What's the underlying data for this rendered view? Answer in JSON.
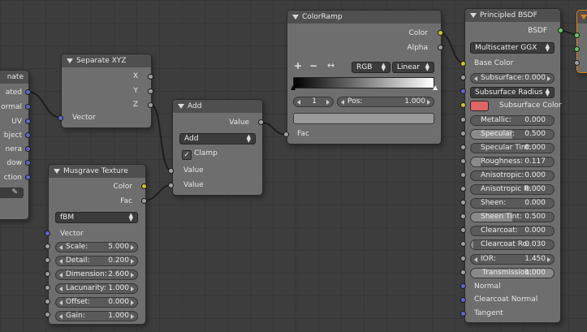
{
  "left_node": {
    "labels": [
      "nate",
      "ated",
      "ormal",
      "UV",
      "bject",
      "nera",
      "dow",
      "ction"
    ]
  },
  "separate_xyz": {
    "title": "Separate XYZ",
    "outputs": [
      "X",
      "Y",
      "Z"
    ],
    "input": "Vector"
  },
  "musgrave": {
    "title": "Musgrave Texture",
    "outputs": [
      "Color",
      "Fac"
    ],
    "mode": "fBM",
    "vector_label": "Vector",
    "params": [
      {
        "label": "Scale:",
        "value": "5.000"
      },
      {
        "label": "Detail:",
        "value": "0.200"
      },
      {
        "label": "Dimension:",
        "value": "2.600"
      },
      {
        "label": "Lacunarity:",
        "value": "1.000"
      },
      {
        "label": "Offset:",
        "value": "0.000"
      },
      {
        "label": "Gain:",
        "value": "1.000"
      }
    ]
  },
  "math_add": {
    "title": "Add",
    "output": "Value",
    "operation": "Add",
    "clamp_label": "Clamp",
    "clamp_checked": true,
    "check_mark": "✓",
    "inputs": [
      "Value",
      "Value"
    ]
  },
  "colorramp": {
    "title": "ColorRamp",
    "outputs": [
      "Color",
      "Alpha"
    ],
    "add_symbol": "+",
    "remove_symbol": "−",
    "flip_symbol": "↔",
    "color_mode": "RGB",
    "interpolation": "Linear",
    "stop_index": "1",
    "pos_label": "Pos:",
    "pos_value": "1.000",
    "input": "Fac"
  },
  "principled": {
    "title": "Principled BSDF",
    "output": "BSDF",
    "distribution": "Multiscatter GGX",
    "base_color_label": "Base Color",
    "subsurface": {
      "label": "Subsurface:",
      "value": "0.000"
    },
    "subsurface_method": "Subsurface Radius",
    "subsurface_color_label": "Subsurface Color",
    "subsurface_color": "#e06464",
    "params": [
      {
        "label": "Metallic:",
        "value": "0.000",
        "fill": 0.0
      },
      {
        "label": "Specular:",
        "value": "0.500",
        "fill": 0.5
      },
      {
        "label": "Specular Tint:",
        "value": "0.000",
        "fill": 0.0
      },
      {
        "label": "Roughness:",
        "value": "0.117",
        "fill": 0.117
      },
      {
        "label": "Anisotropic:",
        "value": "0.000",
        "fill": 0.0
      },
      {
        "label": "Anisotropic R:",
        "value": "0.000",
        "fill": 0.0
      },
      {
        "label": "Sheen:",
        "value": "0.000",
        "fill": 0.0
      },
      {
        "label": "Sheen Tint:",
        "value": "0.500",
        "fill": 0.5
      },
      {
        "label": "Clearcoat:",
        "value": "0.000",
        "fill": 0.0
      },
      {
        "label": "Clearcoat Ro:",
        "value": "0.030",
        "fill": 0.03
      }
    ],
    "ior": {
      "label": "IOR:",
      "value": "1.450"
    },
    "transmission": {
      "label": "Transmission:",
      "value": "1.000"
    },
    "vector_inputs": [
      "Normal",
      "Clearcoat Normal",
      "Tangent"
    ]
  },
  "colors": {
    "node_body": "#6e6e6e",
    "node_header": "#4f4f4f",
    "socket_grey": "#a1a1a1",
    "socket_yellow": "#c7c729",
    "socket_blue": "#6363c7",
    "socket_green": "#63c763",
    "output_node_accent": "#e87d0d"
  }
}
